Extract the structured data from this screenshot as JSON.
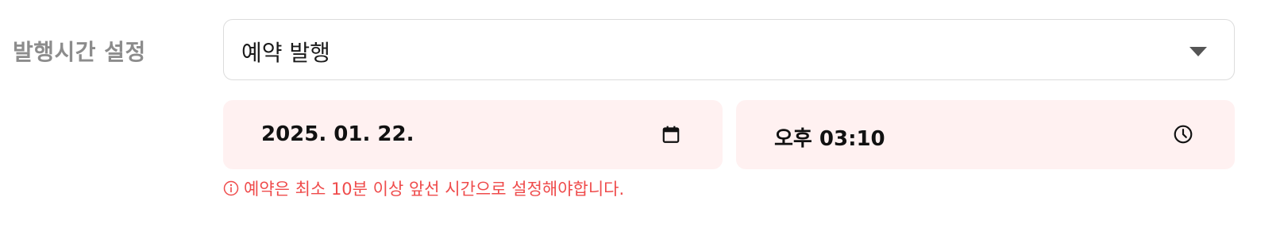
{
  "publish_time": {
    "label": "발행시간 설정",
    "select": {
      "value": "예약 발행",
      "icon": "chevron-down-icon"
    },
    "date_input": {
      "value": "2025. 01. 22.",
      "icon": "calendar-icon"
    },
    "time_input": {
      "value": "오후 03:10",
      "icon": "clock-icon"
    },
    "error": {
      "message": "예약은 최소 10분 이상 앞선 시간으로 설정해야합니다.",
      "icon": "info-icon"
    }
  },
  "colors": {
    "label": "#8c8c8c",
    "input_bg": "#fff1f1",
    "error": "#ef4b4b",
    "border": "#dcdcdc"
  }
}
